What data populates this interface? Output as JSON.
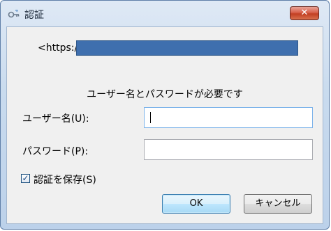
{
  "window": {
    "title": "認証",
    "close_glyph": "✕"
  },
  "dialog": {
    "url_label": "<https:/",
    "prompt": "ユーザー名とパスワードが必要です",
    "username_label": "ユーザー名(U):",
    "username_value": "",
    "password_label": "パスワード(P):",
    "password_value": "",
    "save_label": "認証を保存(S)",
    "save_checked": true,
    "check_glyph": "✓"
  },
  "buttons": {
    "ok_label": "OK",
    "cancel_label": "キャンセル"
  },
  "colors": {
    "redaction": "#3f6fae",
    "close_button": "#c23f22"
  }
}
